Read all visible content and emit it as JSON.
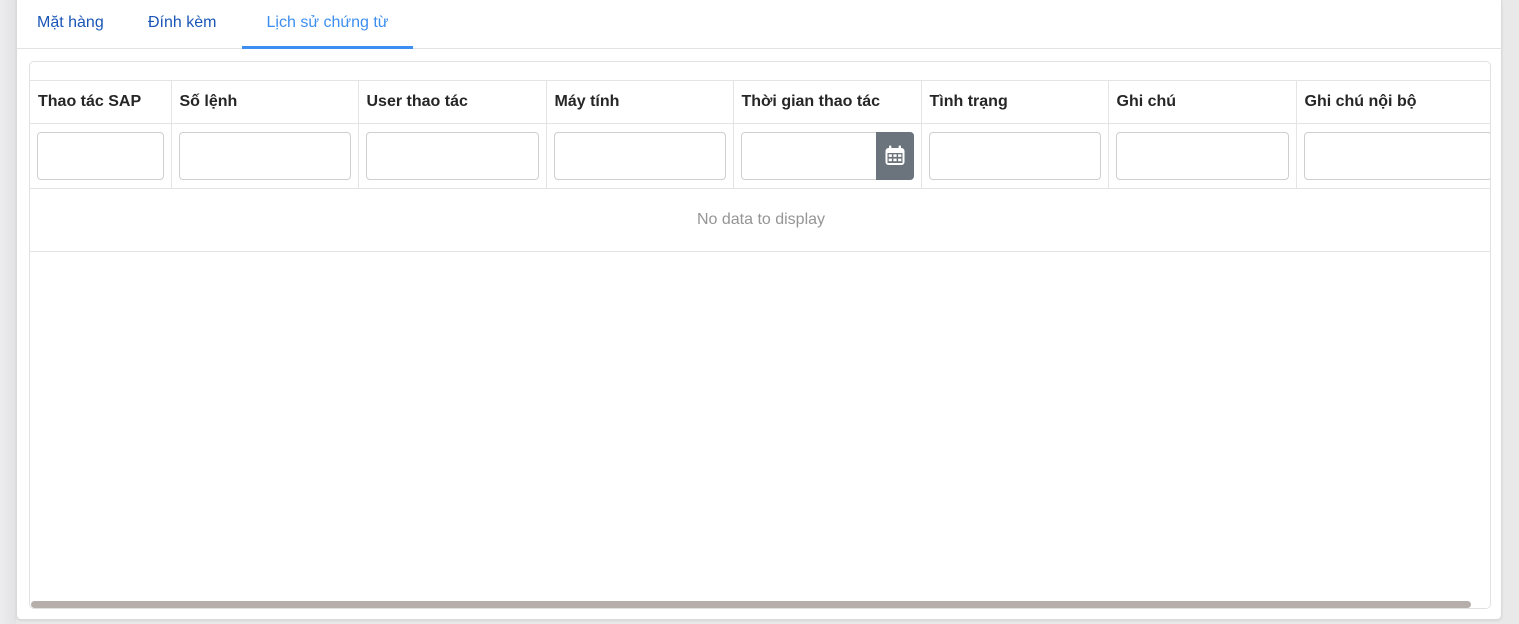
{
  "tabs": [
    {
      "label": "Mặt hàng",
      "active": false
    },
    {
      "label": "Đính kèm",
      "active": false
    },
    {
      "label": "Lịch sử chứng từ",
      "active": true
    }
  ],
  "grid": {
    "columns": [
      "Thao tác SAP",
      "Số lệnh",
      "User thao tác",
      "Máy tính",
      "Thời gian thao tác",
      "Tình trạng",
      "Ghi chú",
      "Ghi chú nội bộ"
    ],
    "filters": [
      "",
      "",
      "",
      "",
      "",
      "",
      "",
      ""
    ],
    "empty_message": "No data to display"
  },
  "icons": {
    "calendar": "calendar-icon"
  },
  "colors": {
    "tab_text": "#1a56b6",
    "tab_active": "#3d8ef0",
    "calendar_button": "#6b747c",
    "scrollbar_thumb": "#b5aeab"
  }
}
